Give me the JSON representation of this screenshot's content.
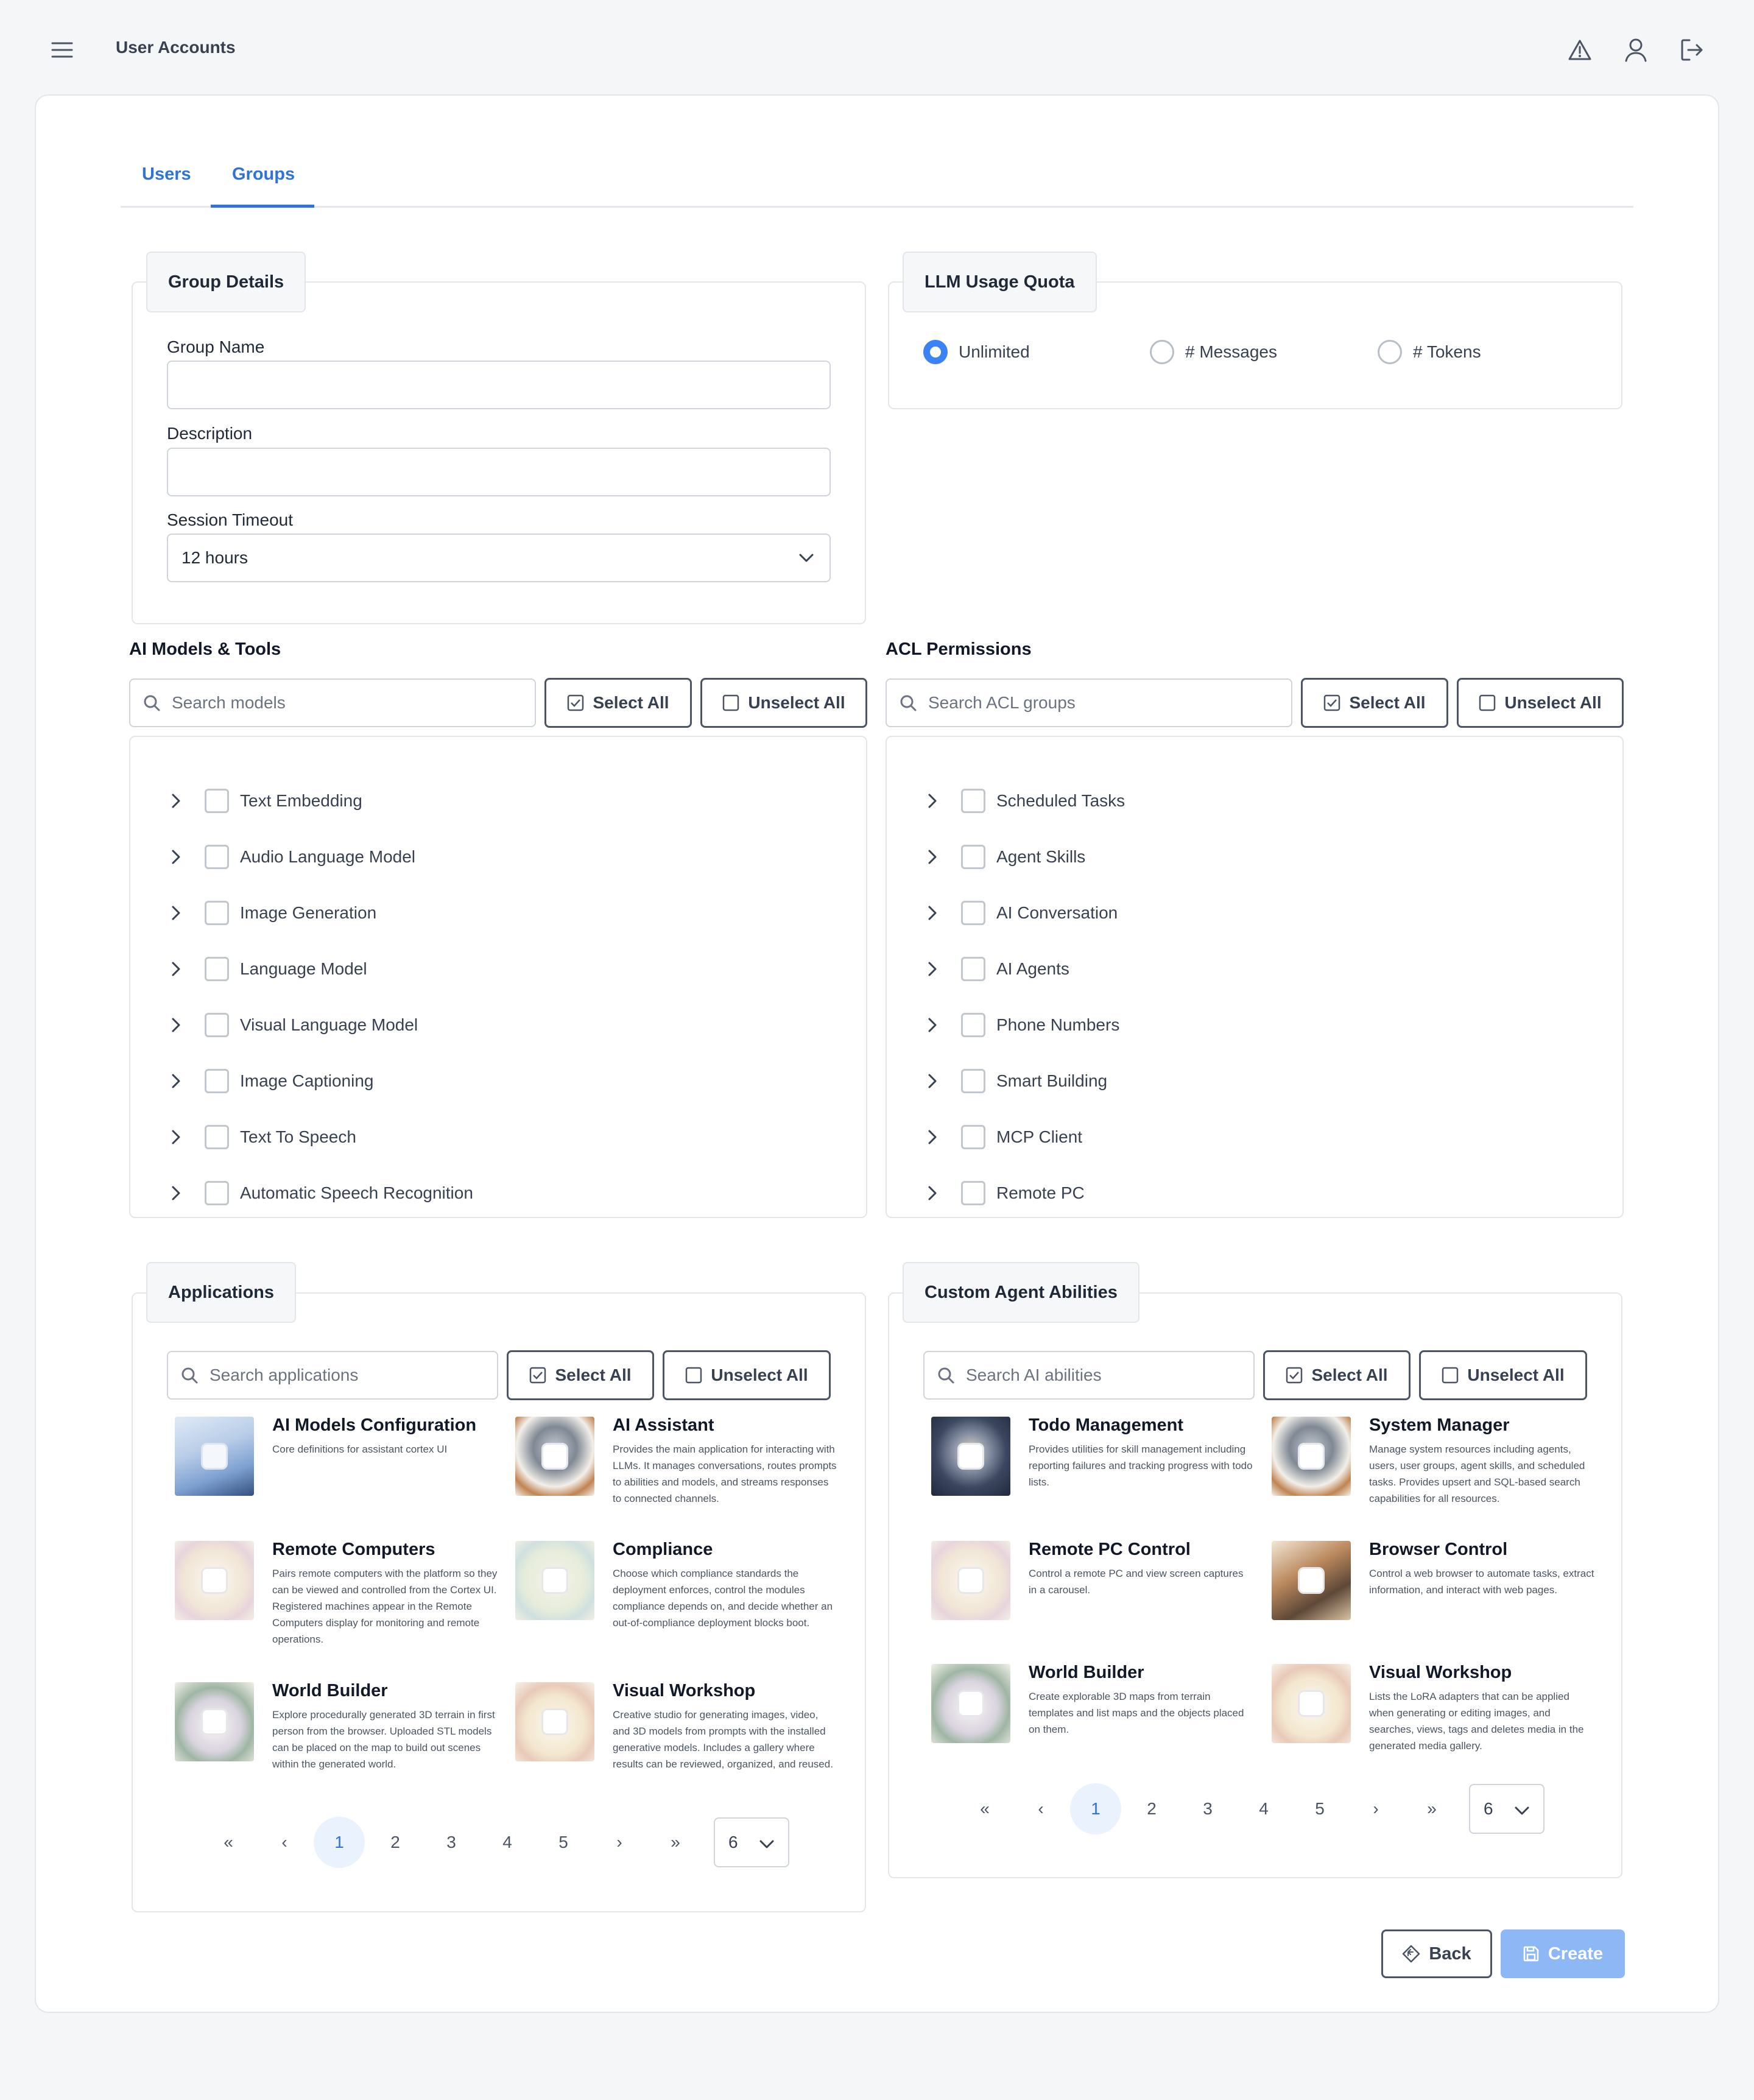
{
  "header": {
    "title": "User Accounts"
  },
  "tabs": [
    {
      "label": "Users"
    },
    {
      "label": "Groups",
      "active": true
    }
  ],
  "group_details": {
    "legend": "Group Details",
    "group_name_label": "Group Name",
    "group_name_value": "",
    "description_label": "Description",
    "description_value": "",
    "session_timeout_label": "Session Timeout",
    "session_timeout_value": "12 hours"
  },
  "llm_quota": {
    "legend": "LLM Usage Quota",
    "options": [
      {
        "label": "Unlimited",
        "selected": true
      },
      {
        "label": "# Messages",
        "selected": false
      },
      {
        "label": "# Tokens",
        "selected": false
      }
    ]
  },
  "ai_models": {
    "title": "AI Models & Tools",
    "search_placeholder": "Search models",
    "select_all": "Select All",
    "unselect_all": "Unselect All",
    "items": [
      "Text Embedding",
      "Audio Language Model",
      "Image Generation",
      "Language Model",
      "Visual Language Model",
      "Image Captioning",
      "Text To Speech",
      "Automatic Speech Recognition"
    ]
  },
  "acl": {
    "title": "ACL Permissions",
    "search_placeholder": "Search ACL groups",
    "select_all": "Select All",
    "unselect_all": "Unselect All",
    "items": [
      "Scheduled Tasks",
      "Agent Skills",
      "AI Conversation",
      "AI Agents",
      "Phone Numbers",
      "Smart Building",
      "MCP Client",
      "Remote PC"
    ]
  },
  "applications": {
    "legend": "Applications",
    "search_placeholder": "Search applications",
    "select_all": "Select All",
    "unselect_all": "Unselect All",
    "items": [
      {
        "name": "AI Models Configuration",
        "desc": "Core definitions for assistant cortex UI",
        "thumb": "hall"
      },
      {
        "name": "AI Assistant",
        "desc": "Provides the main application for interacting with LLMs. It manages conversations, routes prompts to abilities and models, and streams responses to connected channels.",
        "thumb": "crystal-ball"
      },
      {
        "name": "Remote Computers",
        "desc": "Pairs remote computers with the platform so they can be viewed and controlled from the Cortex UI. Registered machines appear in the Remote Computers display for monitoring and remote operations.",
        "thumb": "floral"
      },
      {
        "name": "Compliance",
        "desc": "Choose which compliance standards the deployment enforces, control the modules compliance depends on, and decide whether an out-of-compliance deployment blocks boot.",
        "thumb": "floral-blue"
      },
      {
        "name": "World Builder",
        "desc": "Explore procedurally generated 3D terrain in first person from the browser. Uploaded STL models can be placed on the map to build out scenes within the generated world.",
        "thumb": "landscape"
      },
      {
        "name": "Visual Workshop",
        "desc": "Creative studio for generating images, video, and 3D models from prompts with the installed generative models. Includes a gallery where results can be reviewed, organized, and reused.",
        "thumb": "art"
      }
    ],
    "pagination": {
      "first": "«",
      "prev": "‹",
      "pages": [
        "1",
        "2",
        "3",
        "4",
        "5"
      ],
      "current": "1",
      "next": "›",
      "last": "»",
      "page_size": "6"
    }
  },
  "abilities": {
    "legend": "Custom Agent Abilities",
    "search_placeholder": "Search AI abilities",
    "select_all": "Select All",
    "unselect_all": "Unselect All",
    "items": [
      {
        "name": "Todo Management",
        "desc": "Provides utilities for skill management including reporting failures and tracking progress with todo lists.",
        "thumb": "lantern"
      },
      {
        "name": "System Manager",
        "desc": "Manage system resources including agents, users, user groups, agent skills, and scheduled tasks. Provides upsert and SQL-based search capabilities for all resources.",
        "thumb": "crystal-ball"
      },
      {
        "name": "Remote PC Control",
        "desc": "Control a remote PC and view screen captures in a carousel.",
        "thumb": "floral"
      },
      {
        "name": "Browser Control",
        "desc": "Control a web browser to automate tasks, extract information, and interact with web pages.",
        "thumb": "keyboard"
      },
      {
        "name": "World Builder",
        "desc": "Create explorable 3D maps from terrain templates and list maps and the objects placed on them.",
        "thumb": "landscape"
      },
      {
        "name": "Visual Workshop",
        "desc": "Lists the LoRA adapters that can be applied when generating or editing images, and searches, views, tags and deletes media in the generated media gallery.",
        "thumb": "art"
      }
    ],
    "pagination": {
      "first": "«",
      "prev": "‹",
      "pages": [
        "1",
        "2",
        "3",
        "4",
        "5"
      ],
      "current": "1",
      "next": "›",
      "last": "»",
      "page_size": "6"
    }
  },
  "actions": {
    "back": "Back",
    "create": "Create"
  },
  "colors": {
    "accent": "#2f73d6",
    "radio_on": "#3b82f6",
    "create_disabled": "#8db8f5"
  }
}
